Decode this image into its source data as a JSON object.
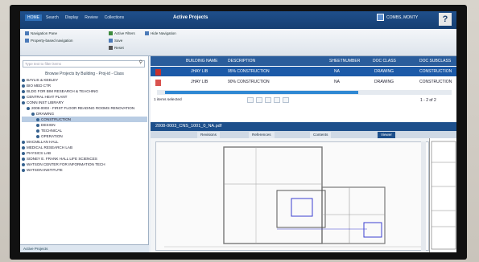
{
  "window": {
    "title": "Active Projects",
    "user": "COMBS, MONTY",
    "help": "?"
  },
  "ribbon": {
    "tabs": [
      "HOME",
      "Search",
      "Display",
      "Review",
      "Collections"
    ],
    "buttons": {
      "navigation_pane": "Navigation Pane",
      "property_based_navigation": "Property-based navigation",
      "active_filters": "Active Filters",
      "hide_navigation": "Hide Navigation",
      "save": "Save",
      "reset": "Reset"
    }
  },
  "left": {
    "search_placeholder": "Type text to filter items",
    "tree_header": "Browse Projects by Building - Proj-id - Class",
    "tree_items": [
      "BAYLIS & KEELEY",
      "BIO MED CTR",
      "BLDG FOR BIM RESEARCH & TEACHING",
      "CENTRAL HEAT PLANT",
      "CONN INST LIBRARY",
      "2008-0003 - FIRST FLOOR READING ROOMS RENOVATION",
      "DRAWING",
      "CONSTRUCTION",
      "DESIGN",
      "TECHNICAL",
      "OPERATION",
      "MACMILLAN HALL",
      "MEDICAL RESEARCH LAB",
      "PHYSICS LAB",
      "SIDNEY E. FRANK HALL LIFE SCIENCES",
      "WATSON CENTER FOR INFORMATION TECH",
      "WATSON INSTITUTE"
    ],
    "footer": "Active Projects"
  },
  "grid": {
    "columns": [
      "BUILDING NAME",
      "DESCRIPTION",
      "SHEETNUMBER",
      "DOC CLASS",
      "DOC SUBCLASS"
    ],
    "rows": [
      [
        "JHAY LIB",
        "95% CONSTRUCTION",
        "NA",
        "DRAWING",
        "CONSTRUCTION"
      ],
      [
        "JHAY LIB",
        "90% CONSTRUCTION",
        "NA",
        "DRAWING",
        "CONSTRUCTION"
      ]
    ],
    "status": "1 items selected",
    "page_count": "1 - 2 of 2"
  },
  "viewer": {
    "filename": "2008-0003_CNS_1001_0_NA.pdf",
    "tabs": [
      "Revisions",
      "References",
      "Contents",
      "Viewer"
    ]
  }
}
